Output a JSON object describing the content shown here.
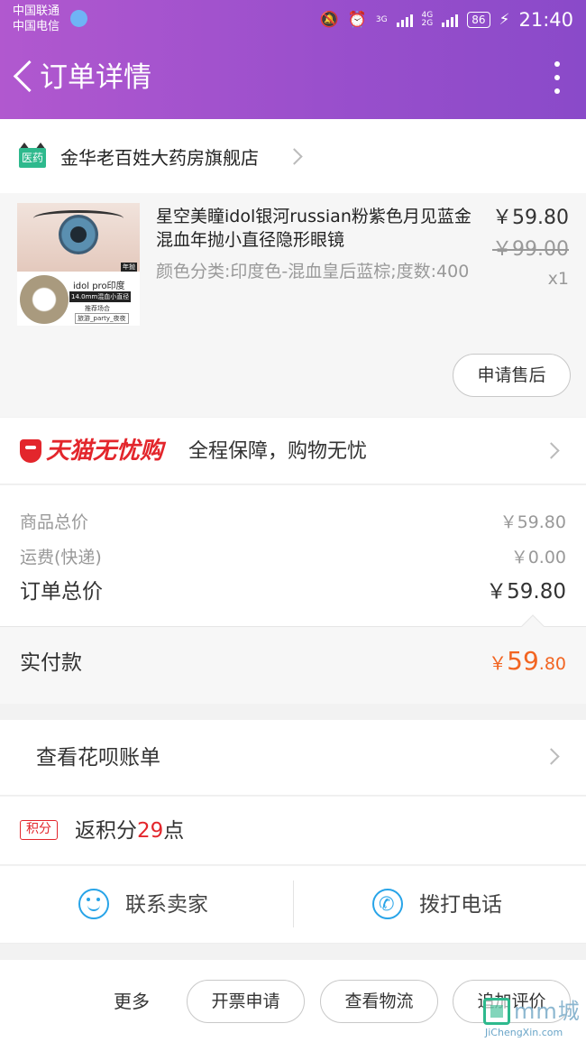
{
  "status_bar": {
    "carrier_1": "中国联通",
    "carrier_2": "中国电信",
    "network_1": "3G",
    "network_2": "4G",
    "network_3": "2G",
    "battery": "86",
    "time": "21:40"
  },
  "nav": {
    "title": "订单详情",
    "back_icon": "chevron-left-icon",
    "more_icon": "vertical-ellipsis-icon"
  },
  "shop": {
    "logo_text": "医药",
    "name": "金华老百姓大药房旗舰店"
  },
  "product": {
    "title": "星空美瞳idol银河russian粉紫色月见蓝金混血年抛小直径隐形眼镜",
    "spec": "颜色分类:印度色-混血皇后蓝棕;度数:400",
    "price": "￥59.80",
    "original_price": "￥99.00",
    "quantity": "x1",
    "image_tag": "年抛",
    "image_brand": "idol pro印度",
    "image_spec": "14.0mm混血小直径",
    "image_note": "推荐场合",
    "image_occasions": "旅游_party_夜夜",
    "after_sale_label": "申请售后"
  },
  "guarantee": {
    "brand": "天猫无忧购",
    "text": "全程保障，购物无忧"
  },
  "totals": {
    "goods_label": "商品总价",
    "goods_value": "￥59.80",
    "shipping_label": "运费(快递)",
    "shipping_value": "￥0.00",
    "order_label": "订单总价",
    "order_value": "￥59.80"
  },
  "paid": {
    "label": "实付款",
    "currency": "￥",
    "integer": "59",
    "decimal": ".80"
  },
  "huabei": {
    "label": "查看花呗账单"
  },
  "points": {
    "badge": "积分",
    "prefix": "返积分",
    "count": "29",
    "suffix": "点"
  },
  "contact": {
    "seller_label": "联系卖家",
    "call_label": "拨打电话"
  },
  "actions": {
    "more_label": "更多",
    "invoice_label": "开票申请",
    "logistics_label": "查看物流",
    "review_label": "追加评价"
  },
  "watermark": {
    "title": "mm城",
    "url": "JiChengXin.com"
  },
  "colors": {
    "header_start": "#b158cf",
    "header_end": "#8a4ac9",
    "accent_red": "#e3262c",
    "pay_orange": "#f26522",
    "contact_blue": "#28a4e8",
    "shop_green": "#2eb98d"
  }
}
